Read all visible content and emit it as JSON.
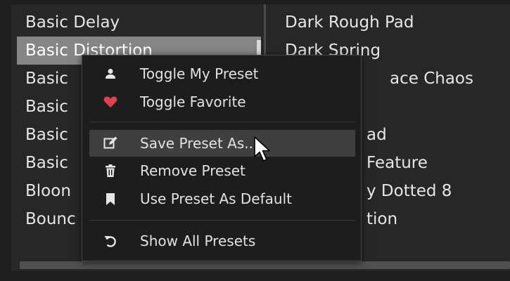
{
  "colors": {
    "background": "#272727",
    "selected_row": "#858585",
    "menu_bg": "#1d1d1d",
    "menu_hover": "#3f3f3f",
    "heart": "#e04050",
    "icon": "#e6e6e6"
  },
  "left_list": {
    "items": [
      "Basic Delay",
      "Basic Distortion",
      "Basic",
      "Basic",
      "Basic",
      "Basic",
      "Bloon",
      "Bounc"
    ],
    "selected_index": 1
  },
  "right_list": {
    "items": [
      "Dark Rough Pad",
      "Dark Spring",
      "ace Chaos",
      "",
      "ad",
      "Feature",
      "y Dotted 8",
      "tion"
    ]
  },
  "context_menu": {
    "items": [
      {
        "label": "Toggle My Preset",
        "icon": "person-icon"
      },
      {
        "label": "Toggle Favorite",
        "icon": "heart-icon"
      },
      {
        "label": "Save Preset As...",
        "icon": "edit-icon"
      },
      {
        "label": "Remove Preset",
        "icon": "trash-icon"
      },
      {
        "label": "Use Preset As Default",
        "icon": "bookmark-icon"
      },
      {
        "label": "Show All Presets",
        "icon": "undo-icon"
      }
    ],
    "hovered_item": "Save Preset As..."
  }
}
